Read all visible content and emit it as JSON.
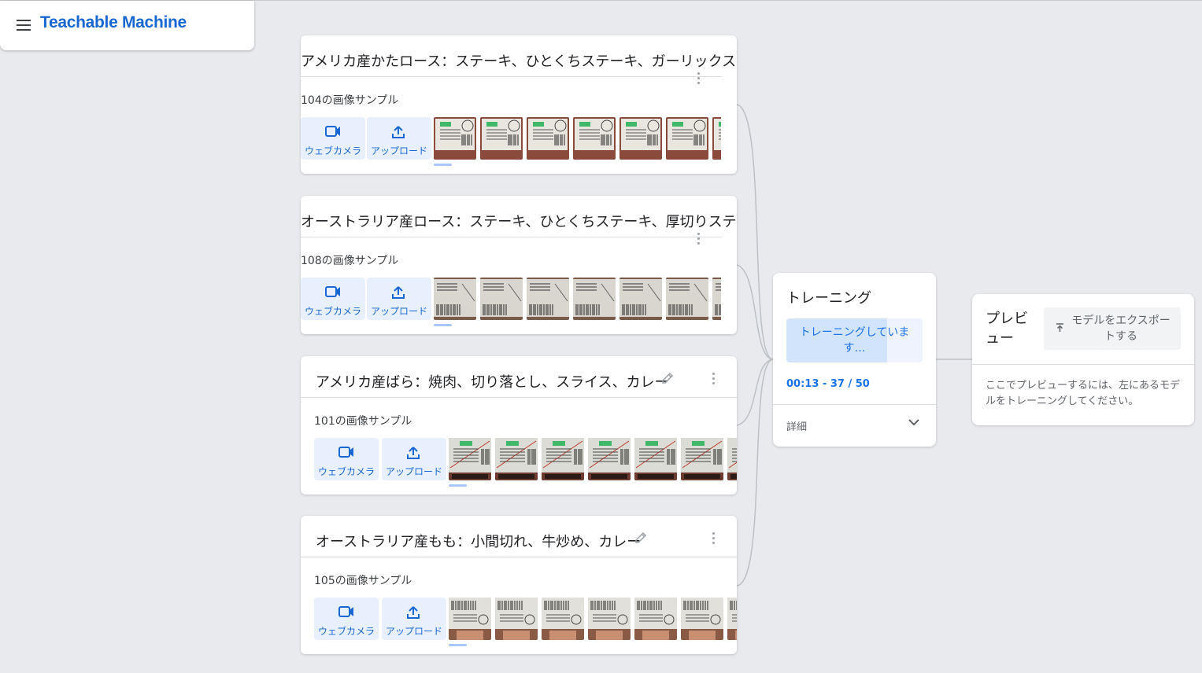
{
  "app": {
    "title": "Teachable Machine"
  },
  "classes": [
    {
      "name": "アメリカ産かたロース：ステーキ、ひとくちステーキ、ガーリックステーキ",
      "sample_count": "104の画像サンプル",
      "webcam_label": "ウェブカメラ",
      "upload_label": "アップロード"
    },
    {
      "name": "オーストラリア産ロース：ステーキ、ひとくちステーキ、厚切りステーキ",
      "sample_count": "108の画像サンプル",
      "webcam_label": "ウェブカメラ",
      "upload_label": "アップロード"
    },
    {
      "name": "アメリカ産ばら：焼肉、切り落とし、スライス、カレー",
      "sample_count": "101の画像サンプル",
      "webcam_label": "ウェブカメラ",
      "upload_label": "アップロード"
    },
    {
      "name": "オーストラリア産もも：小間切れ、牛炒め、カレー",
      "sample_count": "105の画像サンプル",
      "webcam_label": "ウェブカメラ",
      "upload_label": "アップロード"
    }
  ],
  "training": {
    "title": "トレーニング",
    "button_label": "トレーニングしています…",
    "progress": 0.74,
    "status": "00:13 - 37 / 50",
    "details_label": "詳細"
  },
  "preview": {
    "title": "プレビュー",
    "export_label": "モデルをエクスポートする",
    "hint": "ここでプレビューするには、左にあるモデルをトレーニングしてください。"
  },
  "colors": {
    "accent": "#1967d2",
    "button_bg": "#e8f0fe",
    "background": "#e8eaed"
  }
}
